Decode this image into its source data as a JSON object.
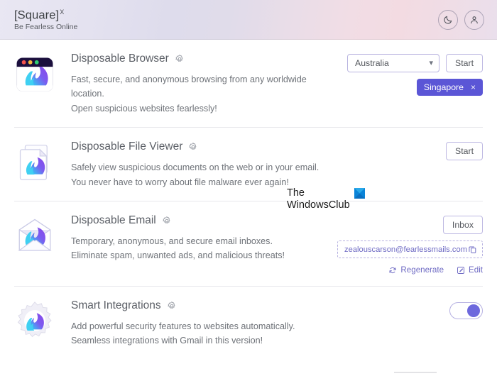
{
  "header": {
    "brand_name": "[Square]",
    "brand_superscript": "X",
    "tagline": "Be Fearless Online",
    "dark_mode_icon": "moon-icon",
    "account_icon": "user-icon",
    "gradient_start": "#e9e7f3",
    "gradient_end": "#f3dbe2"
  },
  "accent_color": "#5b56d6",
  "features": [
    {
      "id": "disposable-browser",
      "title": "Disposable Browser",
      "settings_icon": "gear-icon",
      "icon": "browser-flame-icon",
      "desc_line1": "Fast, secure, and anonymous browsing from any worldwide location.",
      "desc_line2": "Open suspicious websites fearlessly!",
      "region_select": {
        "value": "Australia",
        "chevron": "chevron-down-icon"
      },
      "start_label": "Start",
      "session_tag": {
        "label": "Singapore",
        "close": "×"
      }
    },
    {
      "id": "disposable-file-viewer",
      "title": "Disposable File Viewer",
      "settings_icon": "gear-icon",
      "icon": "document-flame-icon",
      "desc_line1": "Safely view suspicious documents on the web or in your email.",
      "desc_line2": "You never have to worry about file malware ever again!",
      "start_label": "Start"
    },
    {
      "id": "disposable-email",
      "title": "Disposable Email",
      "settings_icon": "gear-icon",
      "icon": "envelope-flame-icon",
      "desc_line1": "Temporary, anonymous, and secure email inboxes.",
      "desc_line2": "Eliminate spam, unwanted ads, and malicious threats!",
      "inbox_label": "Inbox",
      "email_address": "zealouscarson@fearlessmails.com",
      "copy_icon": "copy-icon",
      "regenerate_label": "Regenerate",
      "regenerate_icon": "refresh-icon",
      "edit_label": "Edit",
      "edit_icon": "pencil-icon"
    },
    {
      "id": "smart-integrations",
      "title": "Smart Integrations",
      "settings_icon": "gear-icon",
      "icon": "gear-flame-icon",
      "desc_line1": "Add powerful security features to websites automatically.",
      "desc_line2": "Seamless integrations with Gmail in this version!",
      "toggle_state": "on"
    }
  ],
  "watermark": {
    "line1": "The",
    "line2": "WindowsClub",
    "logo_icon": "windowsclub-logo-icon"
  }
}
